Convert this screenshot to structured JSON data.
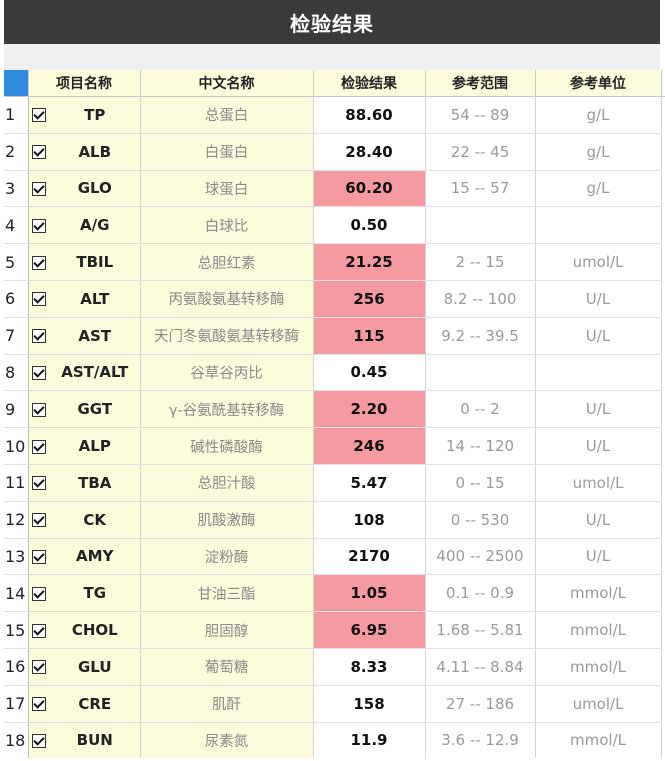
{
  "window": {
    "title": "检验结果"
  },
  "columns": {
    "code": "项目名称",
    "cn_name": "中文名称",
    "value": "检验结果",
    "range": "参考范围",
    "unit": "参考单位"
  },
  "colors": {
    "abnormal_highlight": "#f59aa0",
    "header_bg": "#fcfcdc",
    "corner": "#2f8ae0",
    "titlebar": "#3a3a3a"
  },
  "rows": [
    {
      "index": "1",
      "checked": true,
      "code": "TP",
      "cn_name": "总蛋白",
      "value": "88.60",
      "abnormal": false,
      "range": "54 -- 89",
      "unit": "g/L"
    },
    {
      "index": "2",
      "checked": true,
      "code": "ALB",
      "cn_name": "白蛋白",
      "value": "28.40",
      "abnormal": false,
      "range": "22 -- 45",
      "unit": "g/L"
    },
    {
      "index": "3",
      "checked": true,
      "code": "GLO",
      "cn_name": "球蛋白",
      "value": "60.20",
      "abnormal": true,
      "range": "15 -- 57",
      "unit": "g/L"
    },
    {
      "index": "4",
      "checked": true,
      "code": "A/G",
      "cn_name": "白球比",
      "value": "0.50",
      "abnormal": false,
      "range": "",
      "unit": ""
    },
    {
      "index": "5",
      "checked": true,
      "code": "TBIL",
      "cn_name": "总胆红素",
      "value": "21.25",
      "abnormal": true,
      "range": "2 -- 15",
      "unit": "umol/L"
    },
    {
      "index": "6",
      "checked": true,
      "code": "ALT",
      "cn_name": "丙氨酸氨基转移酶",
      "value": "256",
      "abnormal": true,
      "range": "8.2 -- 100",
      "unit": "U/L"
    },
    {
      "index": "7",
      "checked": true,
      "code": "AST",
      "cn_name": "天门冬氨酸氨基转移酶",
      "value": "115",
      "abnormal": true,
      "range": "9.2 -- 39.5",
      "unit": "U/L"
    },
    {
      "index": "8",
      "checked": true,
      "code": "AST/ALT",
      "cn_name": "谷草谷丙比",
      "value": "0.45",
      "abnormal": false,
      "range": "",
      "unit": ""
    },
    {
      "index": "9",
      "checked": true,
      "code": "GGT",
      "cn_name": "γ-谷氨酰基转移酶",
      "value": "2.20",
      "abnormal": true,
      "range": "0 -- 2",
      "unit": "U/L"
    },
    {
      "index": "10",
      "checked": true,
      "code": "ALP",
      "cn_name": "碱性磷酸酶",
      "value": "246",
      "abnormal": true,
      "range": "14 -- 120",
      "unit": "U/L"
    },
    {
      "index": "11",
      "checked": true,
      "code": "TBA",
      "cn_name": "总胆汁酸",
      "value": "5.47",
      "abnormal": false,
      "range": "0 -- 15",
      "unit": "umol/L"
    },
    {
      "index": "12",
      "checked": true,
      "code": "CK",
      "cn_name": "肌酸激酶",
      "value": "108",
      "abnormal": false,
      "range": "0 -- 530",
      "unit": "U/L"
    },
    {
      "index": "13",
      "checked": true,
      "code": "AMY",
      "cn_name": "淀粉酶",
      "value": "2170",
      "abnormal": false,
      "range": "400 -- 2500",
      "unit": "U/L"
    },
    {
      "index": "14",
      "checked": true,
      "code": "TG",
      "cn_name": "甘油三酯",
      "value": "1.05",
      "abnormal": true,
      "range": "0.1 -- 0.9",
      "unit": "mmol/L"
    },
    {
      "index": "15",
      "checked": true,
      "code": "CHOL",
      "cn_name": "胆固醇",
      "value": "6.95",
      "abnormal": true,
      "range": "1.68 -- 5.81",
      "unit": "mmol/L"
    },
    {
      "index": "16",
      "checked": true,
      "code": "GLU",
      "cn_name": "葡萄糖",
      "value": "8.33",
      "abnormal": false,
      "range": "4.11 -- 8.84",
      "unit": "mmol/L"
    },
    {
      "index": "17",
      "checked": true,
      "code": "CRE",
      "cn_name": "肌酐",
      "value": "158",
      "abnormal": false,
      "range": "27 -- 186",
      "unit": "umol/L"
    },
    {
      "index": "18",
      "checked": true,
      "code": "BUN",
      "cn_name": "尿素氮",
      "value": "11.9",
      "abnormal": false,
      "range": "3.6 -- 12.9",
      "unit": "mmol/L"
    }
  ]
}
